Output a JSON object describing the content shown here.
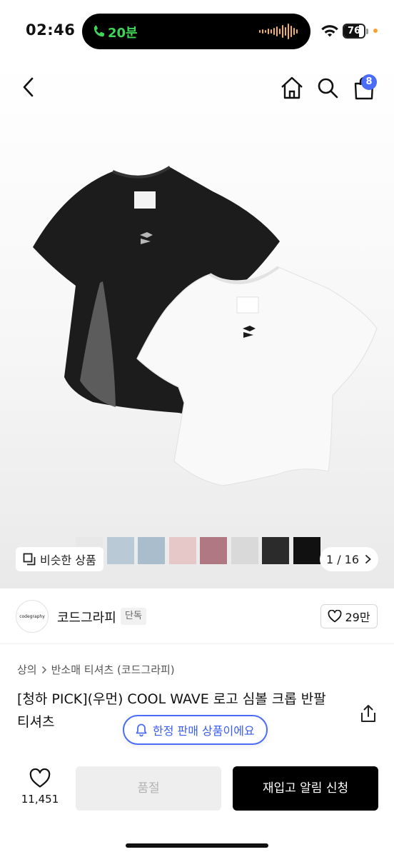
{
  "status": {
    "time": "02:46",
    "call_label": "20분",
    "battery": "76",
    "battery_level": 0.76
  },
  "nav": {
    "cart_count": "8",
    "icons": [
      "back-icon",
      "home-icon",
      "search-icon",
      "cart-icon"
    ]
  },
  "gallery": {
    "similar_label": "비슷한 상품",
    "pager": "1 / 16",
    "thumbnail_colors": [
      "#e6e6e6",
      "#b9c9d6",
      "#a9bdcc",
      "#e6c8c8",
      "#b07883",
      "#d9d9d9",
      "#2b2b2b",
      "#111111"
    ],
    "selected_thumbnail": 0
  },
  "brand": {
    "logo_text": "codegraphy",
    "name": "코드그라피",
    "exclusive_badge": "단독",
    "like_count": "29만"
  },
  "breadcrumb": {
    "category": "상의",
    "subcategory": "반소매 티셔츠 (코드그라피)"
  },
  "product": {
    "title": "[청하 PICK](우먼) COOL WAVE 로고 심볼 크롭 반팔 티셔츠"
  },
  "toast": {
    "label": "한정 판매 상품이에요"
  },
  "bottom": {
    "wish_count": "11,451",
    "soldout_label": "품절",
    "restock_label": "재입고 알림 신청"
  },
  "colors": {
    "accent": "#4a6cf7",
    "call_green": "#3fd45a",
    "primary_button": "#000000"
  }
}
